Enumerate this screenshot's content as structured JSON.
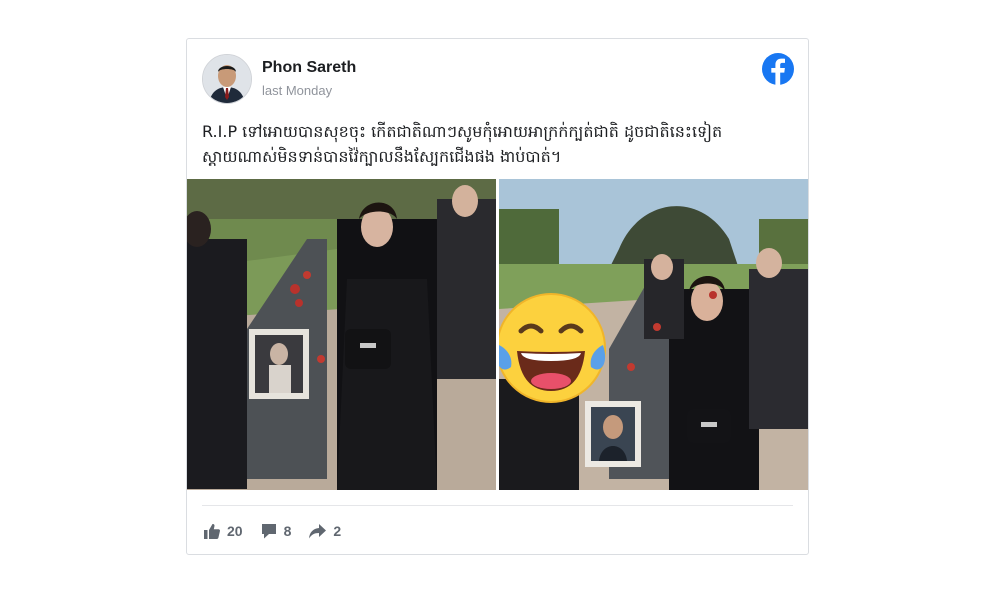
{
  "post": {
    "author": "Phon Sareth",
    "timestamp": "last Monday",
    "text": "R.I.P ទៅអោយបានសុខចុះ កើតជាតិណាៗសូមកុំអោយអាក្រក់ក្បត់ជាតិ ដូចជាតិនេះទៀត\nស្តាយណាស់មិនទាន់បានវ៉ៃក្បាលនឹងស្បែកជើងផង ងាប់បាត់។",
    "platform_icon": "facebook-icon",
    "photos": [
      {
        "name": "photo-1"
      },
      {
        "name": "photo-2",
        "overlay_emoji": "😂"
      }
    ]
  },
  "stats": {
    "likes": "20",
    "comments": "8",
    "shares": "2",
    "like_icon": "thumbs-up-icon",
    "comment_icon": "comment-icon",
    "share_icon": "share-icon"
  },
  "colors": {
    "facebook_blue": "#1877f2",
    "icon_gray": "#606770",
    "text": "#1c1e21",
    "muted": "#90949c",
    "border": "#dadde1"
  }
}
